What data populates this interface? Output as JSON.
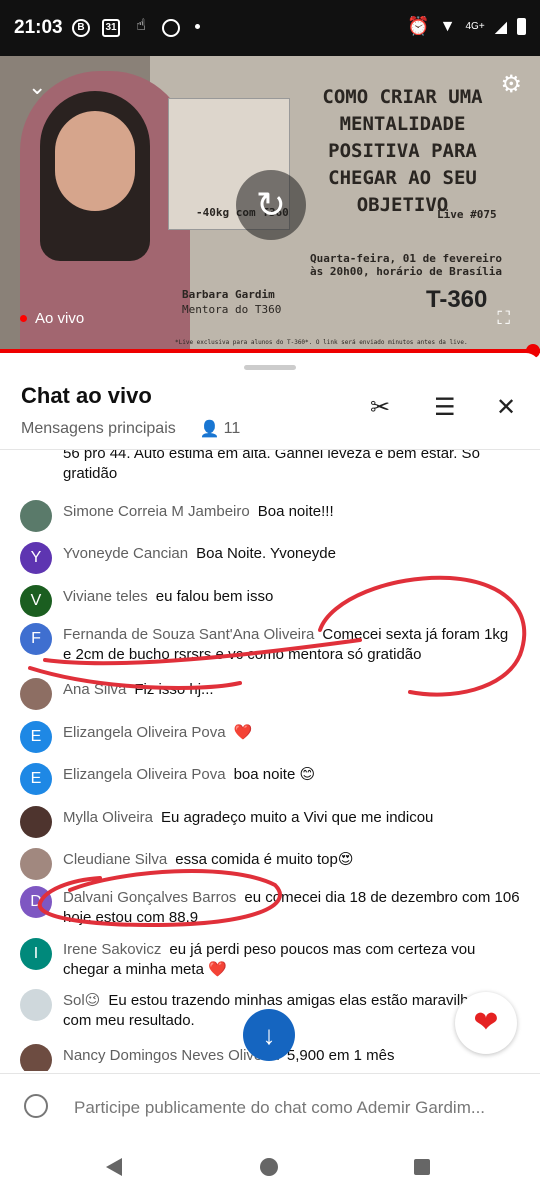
{
  "status_bar": {
    "time": "21:03",
    "icons": [
      "b-icon",
      "calendar-icon",
      "hand-icon",
      "whatsapp-icon",
      "dot"
    ],
    "right_icons": [
      "alarm-icon",
      "wifi-icon",
      "signal-icon",
      "battery-icon"
    ],
    "network": "4G+"
  },
  "video": {
    "title": "COMO CRIAR UMA MENTALIDADE POSITIVA PARA CHEGAR AO SEU OBJETIVO",
    "live_number": "Live #075",
    "date_line1": "Quarta-feira, 01 de fevereiro",
    "date_line2": "às 20h00, horário de Brasília",
    "presenter_name": "Barbara Gardim",
    "presenter_role": "Mentora do T360",
    "photo_caption": "-40kg com T360",
    "logo": "T-360",
    "footer_note": "*Live exclusiva para alunos do T-360*. O link será enviado minutos antes da live.",
    "live_label": "Ao vivo"
  },
  "chat": {
    "title": "Chat ao vivo",
    "filter": "Mensagens principais",
    "viewers": "11",
    "composer_placeholder": "Participe publicamente do chat como Ademir Gardim..."
  },
  "messages": [
    {
      "name": "",
      "text": "56 pro 44. Auto estima em alta. Ganhei leveza e bem estar. Só gratidão",
      "initial": "",
      "color": "#3b5bb7"
    },
    {
      "name": "Simone Correia M Jambeiro",
      "text": "Boa noite!!!",
      "initial": "",
      "color": "#5a7a6a"
    },
    {
      "name": "Yvoneyde Cancian",
      "text": "Boa Noite. Yvoneyde",
      "initial": "Y",
      "color": "#5e35b1"
    },
    {
      "name": "Viviane teles",
      "text": "eu falou bem isso",
      "initial": "V",
      "color": "#1b5e20"
    },
    {
      "name": "Fernanda de Souza Sant'Ana Oliveira",
      "text": "Comecei sexta já foram 1kg e 2cm de bucho rsrsrs e vc como mentora só gratidão",
      "initial": "F",
      "color": "#3f6fd0"
    },
    {
      "name": "Ana Silva",
      "text": "Fiz isso hj...",
      "initial": "",
      "color": "#8d6e63"
    },
    {
      "name": "Elizangela Oliveira Pova",
      "text": "❤️",
      "initial": "E",
      "color": "#1e88e5"
    },
    {
      "name": "Elizangela Oliveira Pova",
      "text": "boa noite 😊",
      "initial": "E",
      "color": "#1e88e5"
    },
    {
      "name": "Mylla Oliveira",
      "text": "Eu agradeço muito a Vivi que me indicou",
      "initial": "",
      "color": "#4e342e"
    },
    {
      "name": "Cleudiane Silva",
      "text": "essa comida é muito top😍",
      "initial": "",
      "color": "#a1887f"
    },
    {
      "name": "Dalvani Gonçalves Barros",
      "text": "eu comecei dia 18 de dezembro com 106 hoje estou com 88.9",
      "initial": "D",
      "color": "#7e57c2"
    },
    {
      "name": "Irene Sakovicz",
      "text": "eu já perdi peso poucos mas com certeza vou chegar a minha meta ❤️",
      "initial": "I",
      "color": "#00897b"
    },
    {
      "name": "Sol😉",
      "text": "Eu estou trazendo minhas amigas elas estão maravilhadas com meu resultado.",
      "initial": "",
      "color": "#cfd8dc"
    },
    {
      "name": "Nancy Domingos Neves Oliveira",
      "text": "5,900 em 1 mês",
      "initial": "",
      "color": "#6d4c41"
    }
  ],
  "accent_colors": {
    "live_red": "#ff0000",
    "annotation_red": "#e0303a",
    "fab_blue": "#1565c0",
    "heart_red": "#e52222"
  }
}
